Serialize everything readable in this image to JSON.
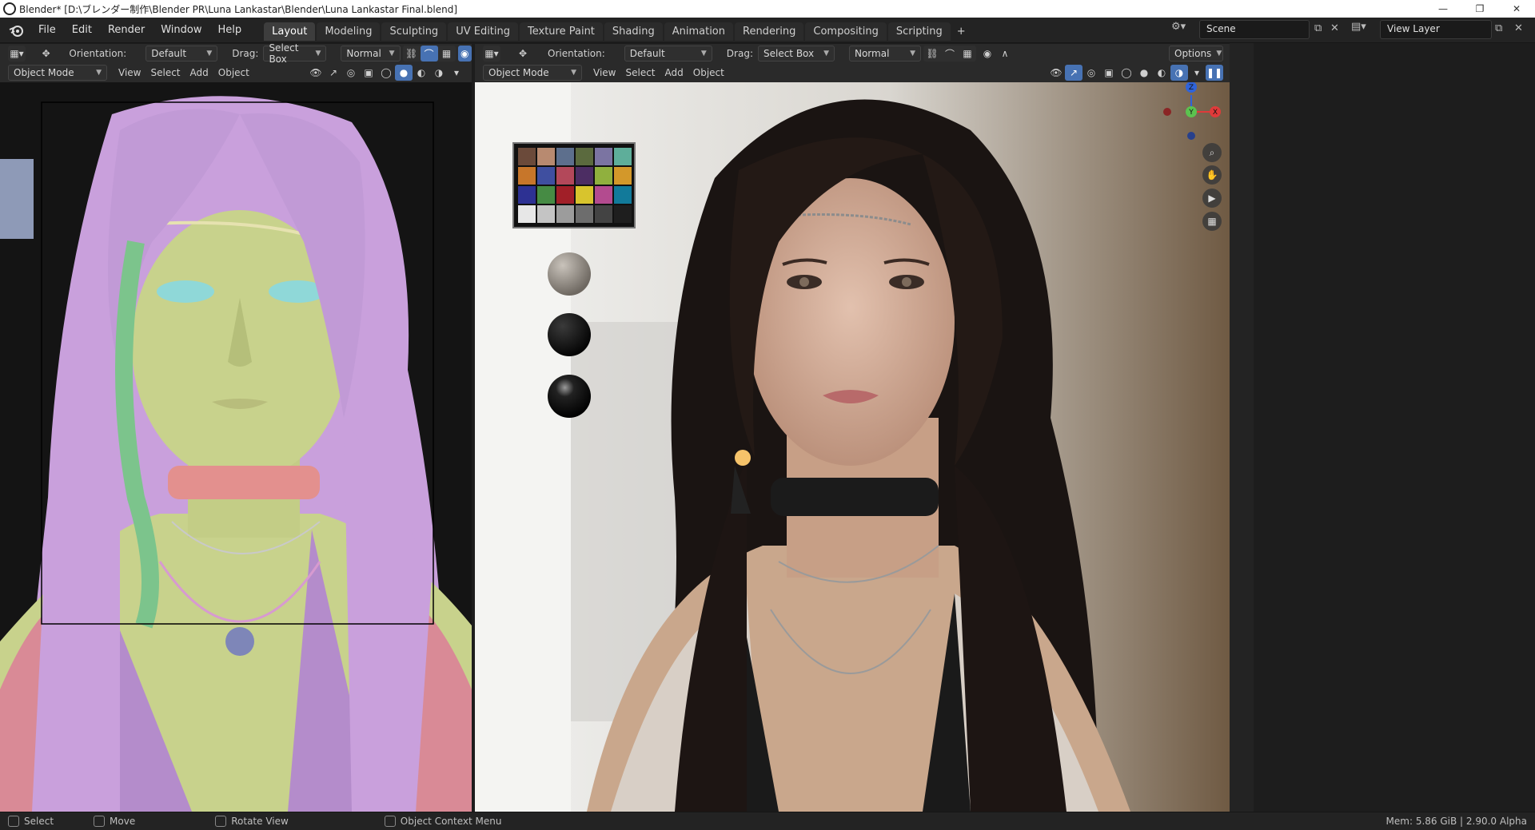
{
  "window": {
    "title": "Blender* [D:\\ブレンダー制作\\Blender PR\\Luna Lankastar\\Blender\\Luna Lankastar Final.blend]",
    "minimize": "—",
    "restore": "❐",
    "close": "✕"
  },
  "menu": [
    "File",
    "Edit",
    "Render",
    "Window",
    "Help"
  ],
  "workspaces": {
    "tabs": [
      "Layout",
      "Modeling",
      "Sculpting",
      "UV Editing",
      "Texture Paint",
      "Shading",
      "Animation",
      "Rendering",
      "Compositing",
      "Scripting"
    ],
    "active": "Layout",
    "add": "+"
  },
  "scene": {
    "label": "Scene"
  },
  "view_layer": {
    "label": "View Layer"
  },
  "left_viewport": {
    "orientation_label": "Orientation:",
    "orientation_value": "Default",
    "drag_label": "Drag:",
    "drag_value": "Select Box",
    "transform_value": "Normal",
    "mode": "Object Mode",
    "menus": [
      "View",
      "Select",
      "Add",
      "Object"
    ]
  },
  "right_viewport": {
    "orientation_label": "Orientation:",
    "orientation_value": "Default",
    "drag_label": "Drag:",
    "drag_value": "Select Box",
    "transform_value": "Normal",
    "options": "Options",
    "mode": "Object Mode",
    "menus": [
      "View",
      "Select",
      "Add",
      "Object"
    ]
  },
  "gizmo": {
    "z": "Z",
    "y": "Y",
    "x": "X"
  },
  "statusbar": {
    "select": "Select",
    "move": "Move",
    "rotate": "Rotate View",
    "context": "Object Context Menu",
    "memory": "Mem: 5.86 GiB | 2.90.0 Alpha"
  },
  "colors": {
    "accent": "#4772b3",
    "hair_left": "#c9a0dc",
    "skin_left": "#c8d28c",
    "braid_left": "#7cc48c",
    "choker_left": "#e3908e"
  },
  "color_checker": [
    "#6b4a3a",
    "#b88a70",
    "#5d6f8d",
    "#5b6a3e",
    "#7b74a2",
    "#5eae9a",
    "#c7762a",
    "#3f4fa0",
    "#b3485a",
    "#4c2d63",
    "#90b03e",
    "#d3982a",
    "#2d3193",
    "#468b44",
    "#a11f28",
    "#d8c42d",
    "#b34b8f",
    "#127a9a",
    "#e7e7e7",
    "#c4c4c4",
    "#9c9c9c",
    "#6d6d6d",
    "#434343",
    "#1e1e1e"
  ]
}
